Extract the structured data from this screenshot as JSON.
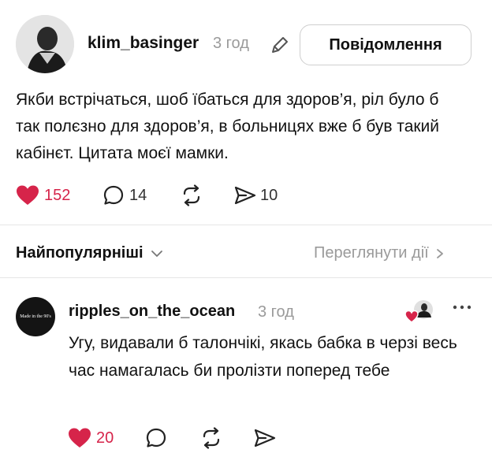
{
  "post": {
    "username": "klim_basinger",
    "time": "3 год",
    "text": "Якби встрічаться, шоб їбаться для здоров’я, ріл було б так полєзно для здоров’я, в больницях вже б був такий кабінєт. Цитата моєї мамки.",
    "actions": {
      "likes": "152",
      "comments": "14",
      "reposts": "",
      "shares": "10"
    },
    "message_button_label": "Повідомлення"
  },
  "sort_bar": {
    "label": "Найпопулярніші",
    "view_activity": "Переглянути дії"
  },
  "comment": {
    "username": "ripples_on_the_ocean",
    "time": "3 год",
    "avatar_text": "Made in the 90's",
    "text": "Угу, видавали б талончікі, якась бабка в черзі весь час намагалась би пролізти поперед тебе",
    "actions": {
      "likes": "20"
    }
  },
  "colors": {
    "like_red": "#d6244a",
    "muted_gray": "#9a9a9a"
  }
}
